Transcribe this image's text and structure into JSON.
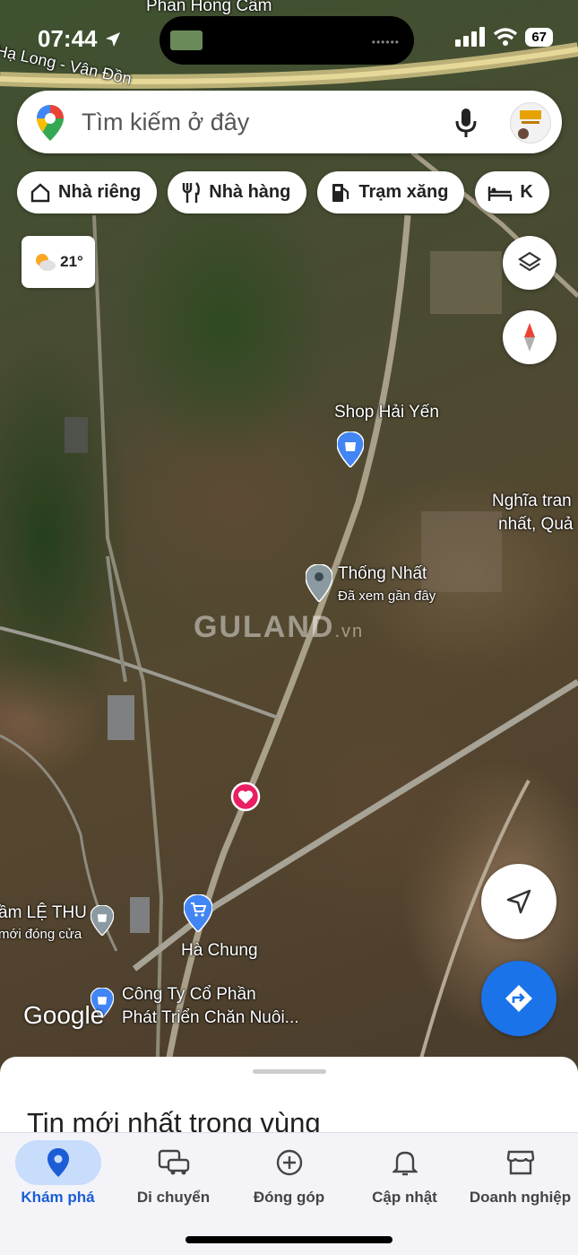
{
  "status_bar": {
    "time": "07:44",
    "battery": "67"
  },
  "search": {
    "placeholder": "Tìm kiếm ở đây"
  },
  "chips": [
    {
      "label": "Nhà riêng",
      "icon": "home-icon"
    },
    {
      "label": "Nhà hàng",
      "icon": "restaurant-icon"
    },
    {
      "label": "Trạm xăng",
      "icon": "gas-station-icon"
    },
    {
      "label": "K",
      "icon": "hotel-icon"
    }
  ],
  "weather": {
    "temp": "21°",
    "icon": "partly-cloudy-icon"
  },
  "map": {
    "top_label": "Phan Hong Cẩm",
    "road_label": "Hạ Long - Vân Đồn",
    "places": {
      "shop": "Shop Hải Yến",
      "cemetery_line1": "Nghĩa tran",
      "cemetery_line2": "nhất, Quả",
      "thong_nhat": "Thống Nhất",
      "thong_nhat_sub": "Đã xem gần đây",
      "le_thu": "ầm LỆ THU",
      "le_thu_sub": "mới đóng cửa",
      "ha_chung": "Hà Chung",
      "company_line1": "Công Ty Cổ Phần",
      "company_line2": "Phát Triển Chăn Nuôi..."
    },
    "watermark": "GULAND",
    "watermark_suffix": ".vn",
    "attribution": "Google"
  },
  "sheet": {
    "title": "Tin mới nhất trong vùng"
  },
  "nav": [
    {
      "label": "Khám phá",
      "icon": "explore-pin-icon",
      "active": true
    },
    {
      "label": "Di chuyển",
      "icon": "commute-icon"
    },
    {
      "label": "Đóng góp",
      "icon": "contribute-plus-icon"
    },
    {
      "label": "Cập nhật",
      "icon": "bell-icon"
    },
    {
      "label": "Doanh nghiệp",
      "icon": "storefront-icon"
    }
  ],
  "colors": {
    "accent": "#1a73e8",
    "pin_red": "#ea4335",
    "active_bg": "#c8dcfb"
  }
}
